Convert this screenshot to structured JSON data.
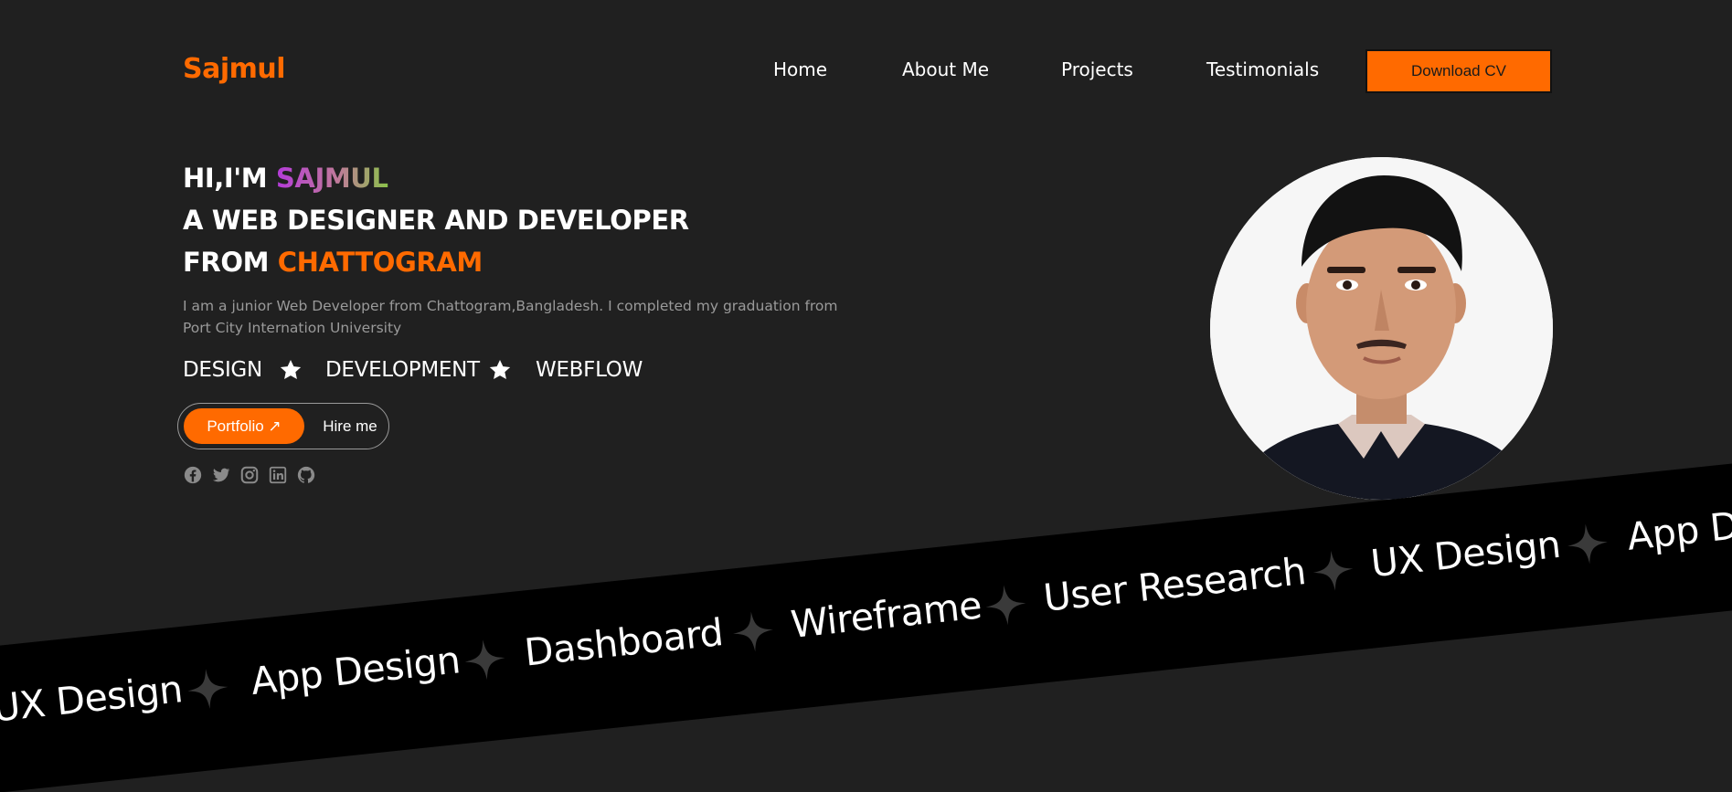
{
  "brand": {
    "logo": "Sajmul",
    "accent": "#ff6a00"
  },
  "nav": {
    "items": [
      "Home",
      "About Me",
      "Projects",
      "Testimonials"
    ],
    "cta": "Download CV"
  },
  "hero": {
    "greeting_prefix": "HI,I'M",
    "greeting_name": "SAJMUL",
    "line2": "A WEB DESIGNER AND DEVELOPER",
    "line3_prefix": "FROM",
    "line3_city": "CHATTOGRAM",
    "intro": "I am a junior Web Developer from Chattogram,Bangladesh. I completed my graduation from Port City Internation University",
    "skills": [
      "DESIGN",
      "DEVELOPMENT",
      "WEBFLOW"
    ],
    "buttons": {
      "portfolio": "Portfolio ↗",
      "hire": "Hire me"
    },
    "social_icons": [
      "facebook-icon",
      "twitter-icon",
      "instagram-icon",
      "linkedin-icon",
      "github-icon"
    ]
  },
  "marquee": {
    "items": [
      "UX Design",
      "App Design",
      "Dashboard",
      "Wireframe",
      "User Research",
      "UX Design",
      "App D"
    ]
  }
}
